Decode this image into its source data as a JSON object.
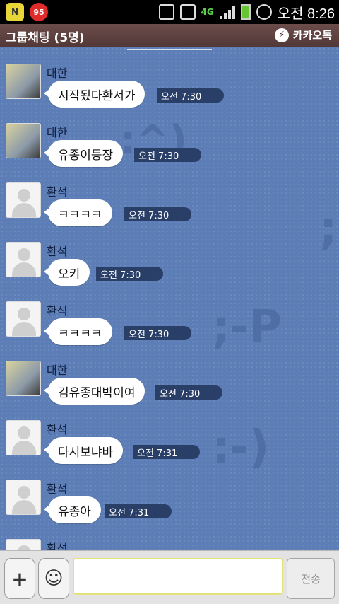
{
  "statusbar": {
    "app1": "N",
    "app2": "95",
    "network": "4G",
    "clock": "오전 8:26"
  },
  "header": {
    "title": "그룹채팅 (5명)",
    "brand": "카카오톡"
  },
  "messages": [
    {
      "sender": "대한",
      "text": "시작됬다환서가",
      "time": "오전 7:30",
      "avatar": "photo"
    },
    {
      "sender": "대한",
      "text": "유종이등장",
      "time": "오전 7:30",
      "avatar": "photo"
    },
    {
      "sender": "환석",
      "text": "ㅋㅋㅋㅋ",
      "time": "오전 7:30",
      "avatar": "blank"
    },
    {
      "sender": "환석",
      "text": "오키",
      "time": "오전 7:30",
      "avatar": "blank"
    },
    {
      "sender": "환석",
      "text": "ㅋㅋㅋㅋ",
      "time": "오전 7:30",
      "avatar": "blank"
    },
    {
      "sender": "대한",
      "text": "김유종대박이여",
      "time": "오전 7:30",
      "avatar": "photo"
    },
    {
      "sender": "환석",
      "text": "다시보냐바",
      "time": "오전 7:31",
      "avatar": "blank"
    },
    {
      "sender": "환석",
      "text": "유종아",
      "time": "오전 7:31",
      "avatar": "blank"
    },
    {
      "sender": "환석",
      "text": "",
      "time": "",
      "avatar": "blank"
    }
  ],
  "watermarks": [
    ":^)",
    ";",
    ";-P",
    ":-)"
  ],
  "input": {
    "plus_label": "+",
    "send_label": "전송"
  }
}
